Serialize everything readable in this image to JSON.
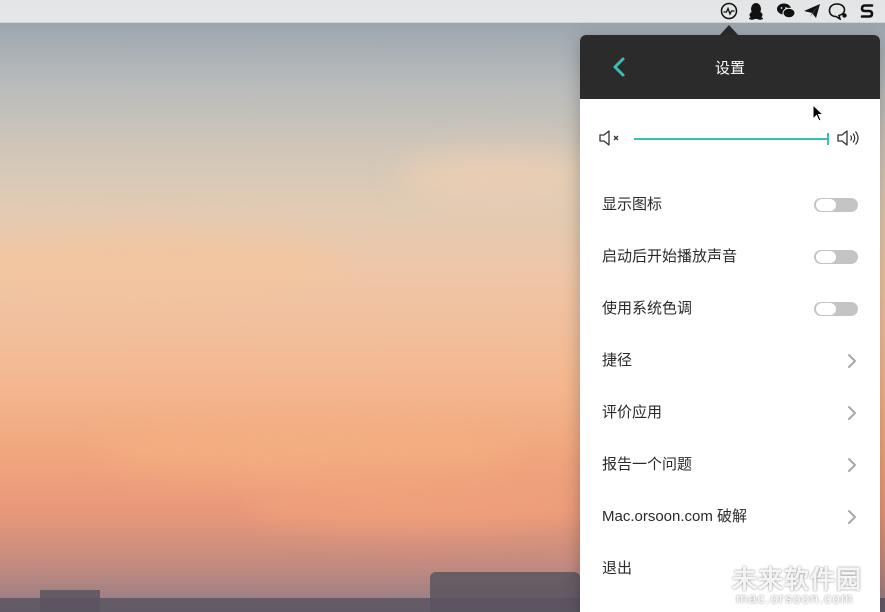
{
  "menubar": {
    "tray_icons": [
      "activity-monitor-icon",
      "qq-icon",
      "wechat-icon",
      "paper-plane-icon",
      "chat-bubble-icon",
      "s-logo-icon"
    ]
  },
  "panel": {
    "title": "设置",
    "volume": {
      "level": 1.0
    },
    "toggles": [
      {
        "label": "显示图标",
        "on": false
      },
      {
        "label": "启动后开始播放声音",
        "on": false
      },
      {
        "label": "使用系统色调",
        "on": false
      }
    ],
    "links": [
      {
        "label": "捷径"
      },
      {
        "label": "评价应用"
      },
      {
        "label": "报告一个问题"
      },
      {
        "label": "Mac.orsoon.com 破解"
      },
      {
        "label": "退出"
      }
    ]
  },
  "watermark": {
    "name": "未来软件园",
    "url": "mac.orsoon.com"
  },
  "colors": {
    "accent": "#3dbdb8",
    "header_bg": "#2b2b2b",
    "toggle_off": "#c4c4c4"
  }
}
